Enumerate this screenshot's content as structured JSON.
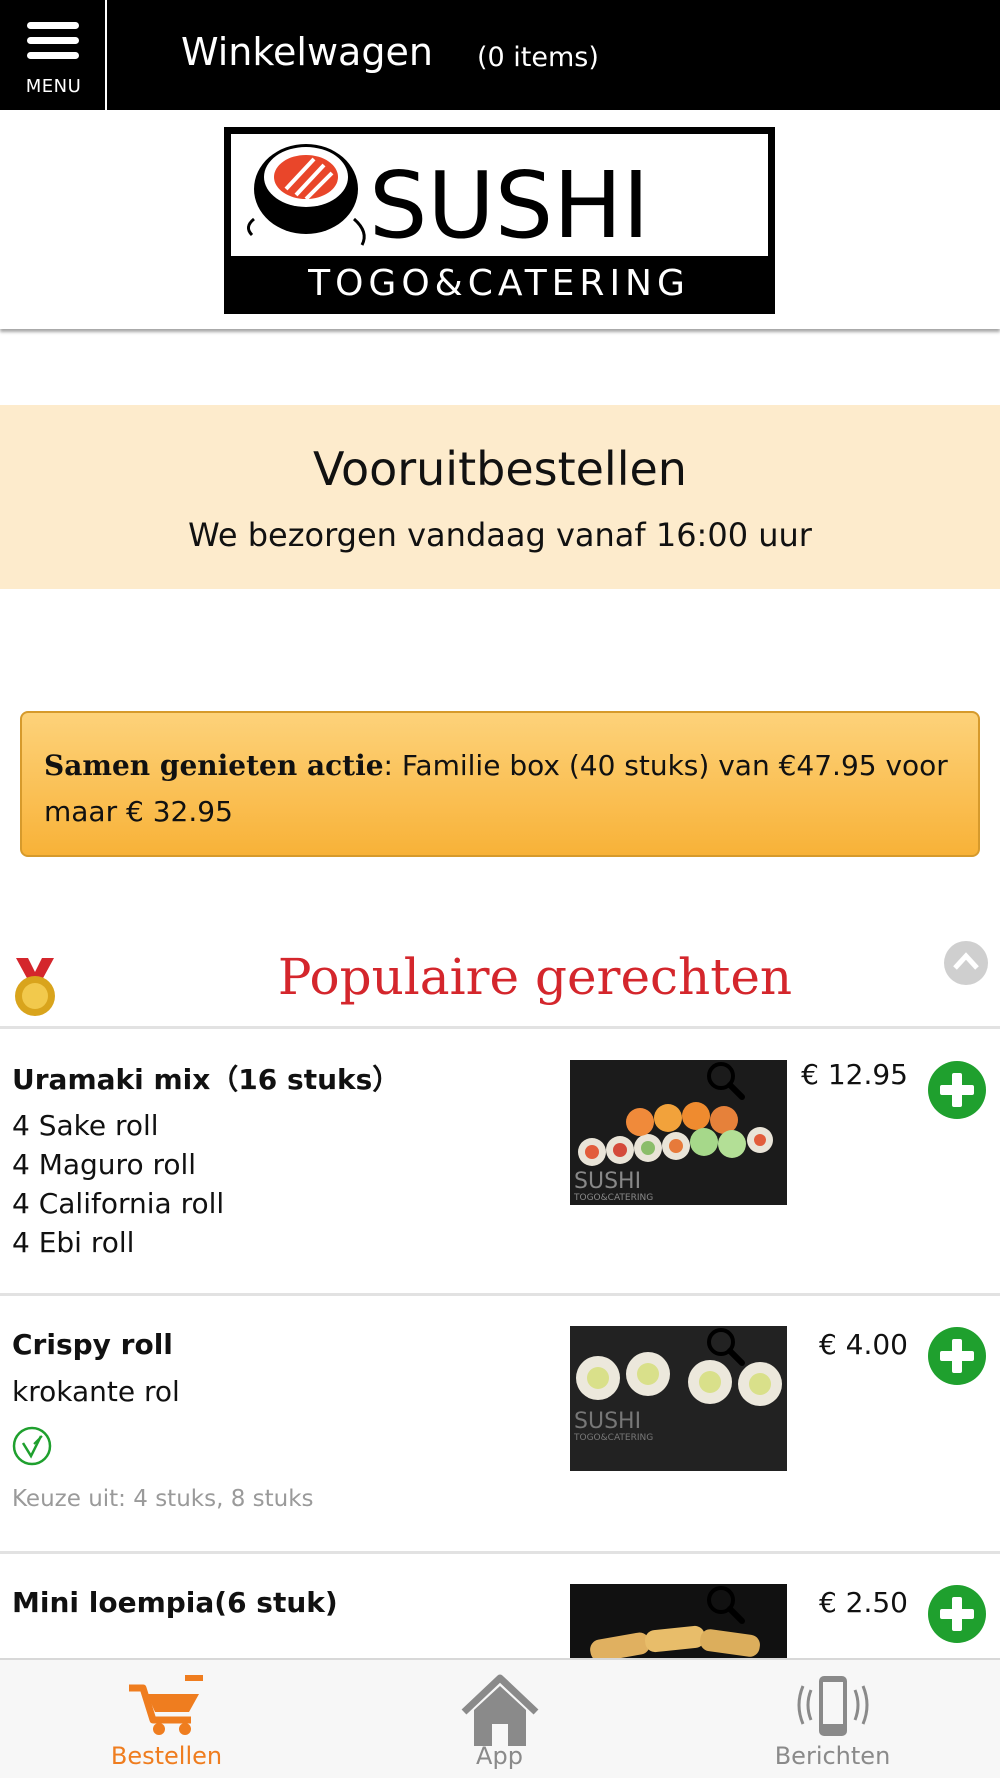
{
  "header": {
    "menu_label": "MENU",
    "cart_title": "Winkelwagen",
    "cart_count": "(0 items)"
  },
  "logo": {
    "brand": "SUSHI",
    "tagline": "TOGO&CATERING"
  },
  "preorder": {
    "title": "Vooruitbestellen",
    "subtitle": "We bezorgen vandaag vanaf 16:00 uur"
  },
  "promo": {
    "bold": "Samen genieten actie",
    "text": ": Familie box (40 stuks) van €47.95 voor maar € 32.95"
  },
  "section": {
    "title": "Populaire gerechten"
  },
  "products": [
    {
      "name": "Uramaki mix（16 stuks）",
      "lines": [
        "4 Sake roll",
        "4 Maguro roll",
        "4 California roll",
        "4 Ebi roll"
      ],
      "price": "€ 12.95"
    },
    {
      "name": "Crispy roll",
      "lines": [
        "krokante rol"
      ],
      "price": "€ 4.00",
      "choice": "Keuze uit: 4 stuks, 8 stuks"
    },
    {
      "name": "Mini loempia(6 stuk)",
      "lines": [],
      "price": "€ 2.50"
    }
  ],
  "image_watermark": "SUSHI",
  "image_watermark_sub": "TOGO&CATERING",
  "bottom_nav": [
    {
      "label": "Bestellen",
      "icon": "cart-icon",
      "active": true
    },
    {
      "label": "App",
      "icon": "home-icon",
      "active": false
    },
    {
      "label": "Berichten",
      "icon": "phone-vibrate-icon",
      "active": false
    }
  ],
  "colors": {
    "accent_orange": "#ef7d1f",
    "section_red": "#d4262c",
    "add_green": "#1fa02e",
    "preorder_bg": "#fdebcc",
    "promo_bg": "#f8b238"
  }
}
